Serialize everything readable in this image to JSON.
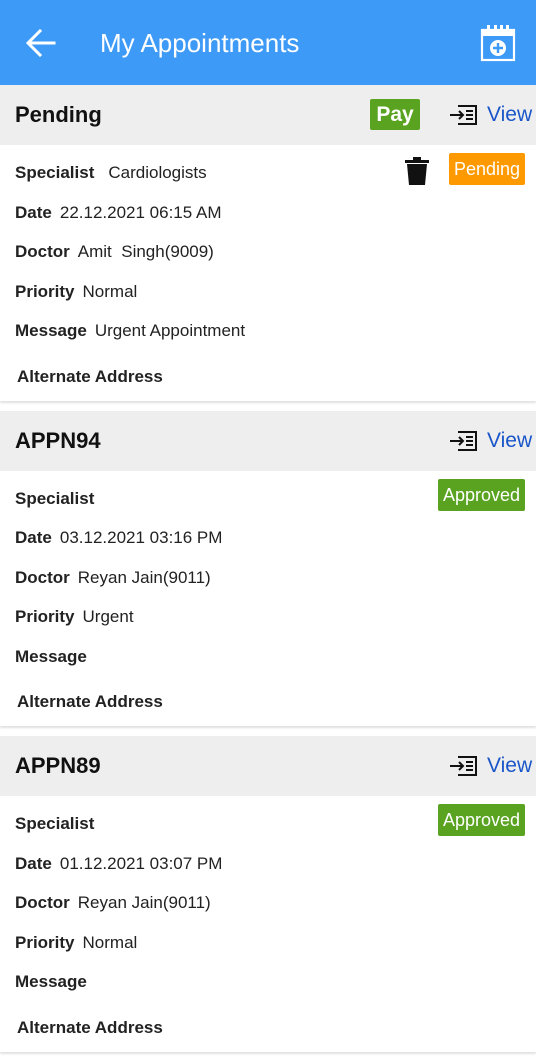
{
  "header": {
    "title": "My Appointments"
  },
  "appointments": [
    {
      "title": "Pending",
      "pay_label": "Pay",
      "view_label": "View",
      "status": "Pending",
      "specialist_label": "Specialist",
      "specialist": "Cardiologists",
      "date_label": "Date",
      "date": "22.12.2021 06:15 AM",
      "doctor_label": "Doctor",
      "doctor": "Amit  Singh(9009)",
      "priority_label": "Priority",
      "priority": "Normal",
      "message_label": "Message",
      "message": "Urgent Appointment",
      "alt_label": "Alternate Address"
    },
    {
      "title": "APPN94",
      "view_label": "View",
      "status": "Approved",
      "specialist_label": "Specialist",
      "specialist": "",
      "date_label": "Date",
      "date": "03.12.2021 03:16 PM",
      "doctor_label": "Doctor",
      "doctor": "Reyan Jain(9011)",
      "priority_label": "Priority",
      "priority": "Urgent",
      "message_label": "Message",
      "message": "",
      "alt_label": "Alternate Address"
    },
    {
      "title": "APPN89",
      "view_label": "View",
      "status": "Approved",
      "specialist_label": "Specialist",
      "specialist": "",
      "date_label": "Date",
      "date": "01.12.2021 03:07 PM",
      "doctor_label": "Doctor",
      "doctor": "Reyan Jain(9011)",
      "priority_label": "Priority",
      "priority": "Normal",
      "message_label": "Message",
      "message": "",
      "alt_label": "Alternate Address"
    }
  ],
  "colors": {
    "appbar": "#3d9af7",
    "pending": "#ff9900",
    "approved": "#59a320",
    "link": "#1a56c9"
  },
  "icons": {
    "back": "arrow-left-icon",
    "add_appointment": "calendar-plus-icon",
    "view": "login-list-icon",
    "delete": "trash-icon"
  }
}
